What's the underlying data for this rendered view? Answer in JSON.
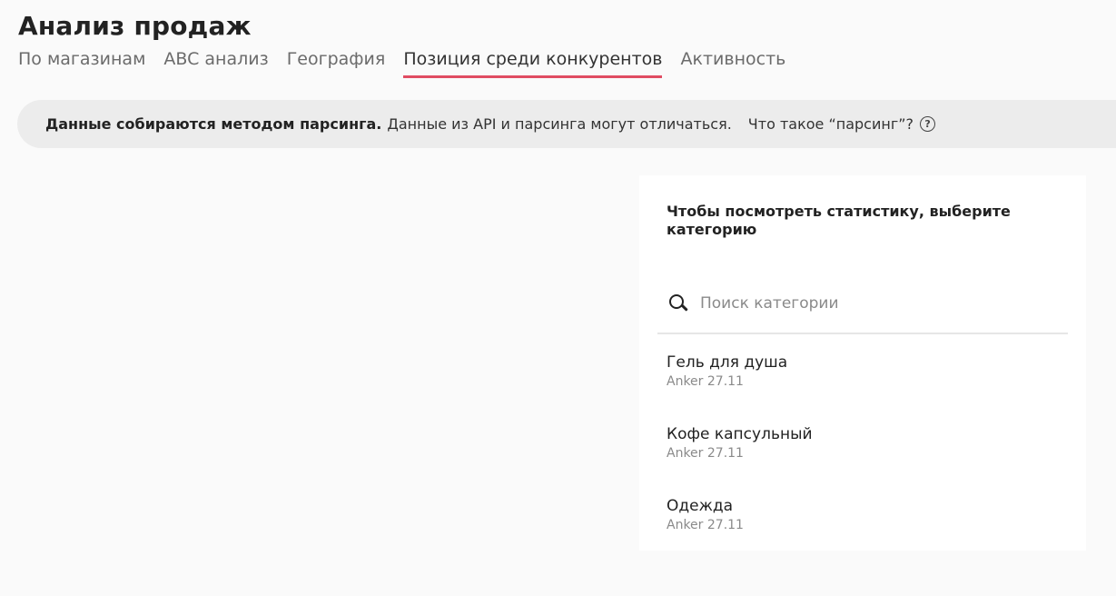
{
  "page": {
    "title": "Анализ продаж"
  },
  "tabs": [
    {
      "label": "По магазинам",
      "active": false
    },
    {
      "label": "ABC анализ",
      "active": false
    },
    {
      "label": "География",
      "active": false
    },
    {
      "label": "Позиция среди конкурентов",
      "active": true
    },
    {
      "label": "Активность",
      "active": false
    }
  ],
  "notice": {
    "bold_text": "Данные собираются методом парсинга.",
    "text": "Данные из API и парсинга могут отличаться.",
    "link_text": "Что такое “парсинг”?",
    "help_icon": "?"
  },
  "panel": {
    "title": "Чтобы посмотреть статистику, выберите категорию",
    "search": {
      "placeholder": "Поиск категории",
      "value": ""
    },
    "items": [
      {
        "name": "Гель для душа",
        "sub": "Anker 27.11"
      },
      {
        "name": "Кофе капсульный",
        "sub": "Anker 27.11"
      },
      {
        "name": "Одежда",
        "sub": "Anker 27.11"
      }
    ]
  },
  "colors": {
    "accent": "#e04c62",
    "background": "#fafafa",
    "notice_bg": "#ececec",
    "panel_bg": "#ffffff"
  }
}
